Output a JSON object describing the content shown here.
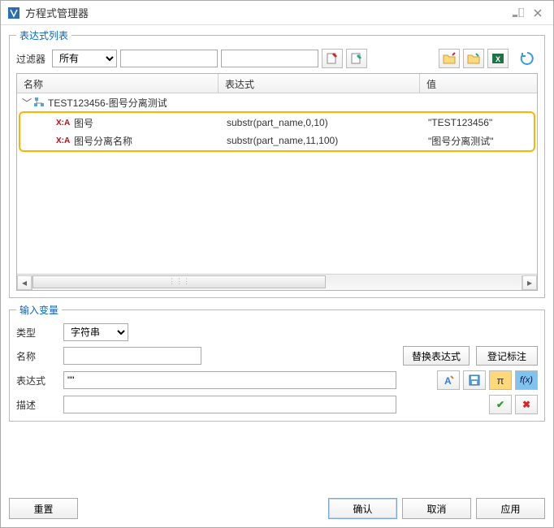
{
  "window": {
    "title": "方程式管理器"
  },
  "exprList": {
    "legend": "表达式列表",
    "filterLabel": "过滤器",
    "filterOptions": [
      "所有"
    ],
    "filterSelected": "所有",
    "columns": {
      "name": "名称",
      "expr": "表达式",
      "value": "值"
    },
    "rootName": "TEST123456-图号分离测试",
    "rows": [
      {
        "name": "图号",
        "expr": "substr(part_name,0,10)",
        "value": "\"TEST123456\""
      },
      {
        "name": "图号分离名称",
        "expr": "substr(part_name,11,100)",
        "value": "\"图号分离测试\""
      }
    ]
  },
  "inputVar": {
    "legend": "输入变量",
    "typeLabel": "类型",
    "typeOptions": [
      "字符串"
    ],
    "typeSelected": "字符串",
    "nameLabel": "名称",
    "nameValue": "",
    "replaceBtn": "替换表达式",
    "registerBtn": "登记标注",
    "exprLabel": "表达式",
    "exprValue": "\"\"",
    "descLabel": "描述",
    "descValue": ""
  },
  "buttons": {
    "reset": "重置",
    "ok": "确认",
    "cancel": "取消",
    "apply": "应用"
  }
}
